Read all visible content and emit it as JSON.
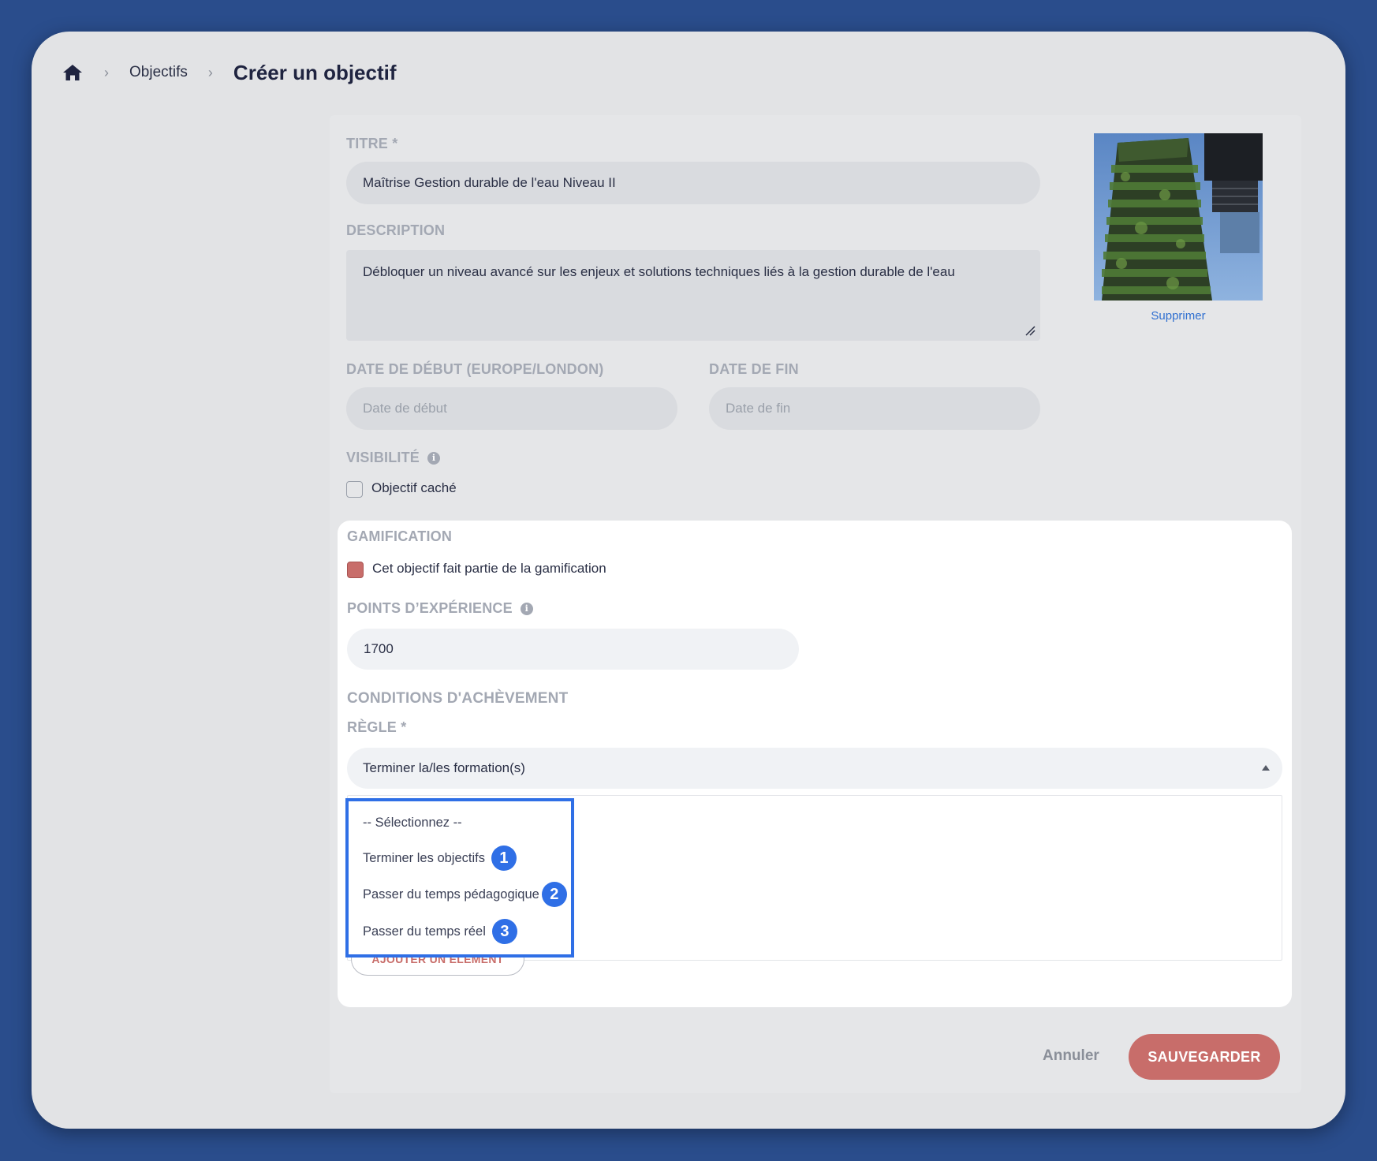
{
  "breadcrumb": {
    "home_icon": "home-icon",
    "parent": "Objectifs",
    "current": "Créer un objectif"
  },
  "form": {
    "title_label": "TITRE *",
    "title_value": "Maîtrise Gestion durable de l'eau Niveau II",
    "description_label": "DESCRIPTION",
    "description_value": "Débloquer un niveau avancé sur les enjeux et solutions techniques liés à la gestion durable de l'eau",
    "start_label": "DATE DE DÉBUT (EUROPE/LONDON)",
    "start_placeholder": "Date de début",
    "end_label": "DATE DE FIN",
    "end_placeholder": "Date de fin",
    "visibility_label": "VISIBILITÉ",
    "hidden_checkbox_label": "Objectif caché",
    "hidden_checked": false,
    "image_delete_label": "Supprimer"
  },
  "gamification": {
    "section_label": "GAMIFICATION",
    "checkbox_label": "Cet objectif fait partie de la gamification",
    "checked": true,
    "xp_label": "POINTS D’EXPÉRIENCE",
    "xp_value": "1700",
    "conditions_label": "CONDITIONS D'ACHÈVEMENT",
    "rule_label": "RÈGLE *",
    "rule_value": "Terminer la/les formation(s)",
    "dropdown_options": [
      {
        "label": "-- Sélectionnez --",
        "badge": ""
      },
      {
        "label": "Terminer les objectifs",
        "badge": "1"
      },
      {
        "label": "Passer du temps pédagogique",
        "badge": "2"
      },
      {
        "label": "Passer du temps réel",
        "badge": "3"
      }
    ],
    "add_element_label": "AJOUTER UN ÉLÉMENT"
  },
  "actions": {
    "cancel_label": "Annuler",
    "save_label": "SAUVEGARDER"
  },
  "colors": {
    "background": "#2a4d8c",
    "accent": "#c86d6a",
    "highlight": "#2f6fe6",
    "link": "#2f6fd0"
  }
}
